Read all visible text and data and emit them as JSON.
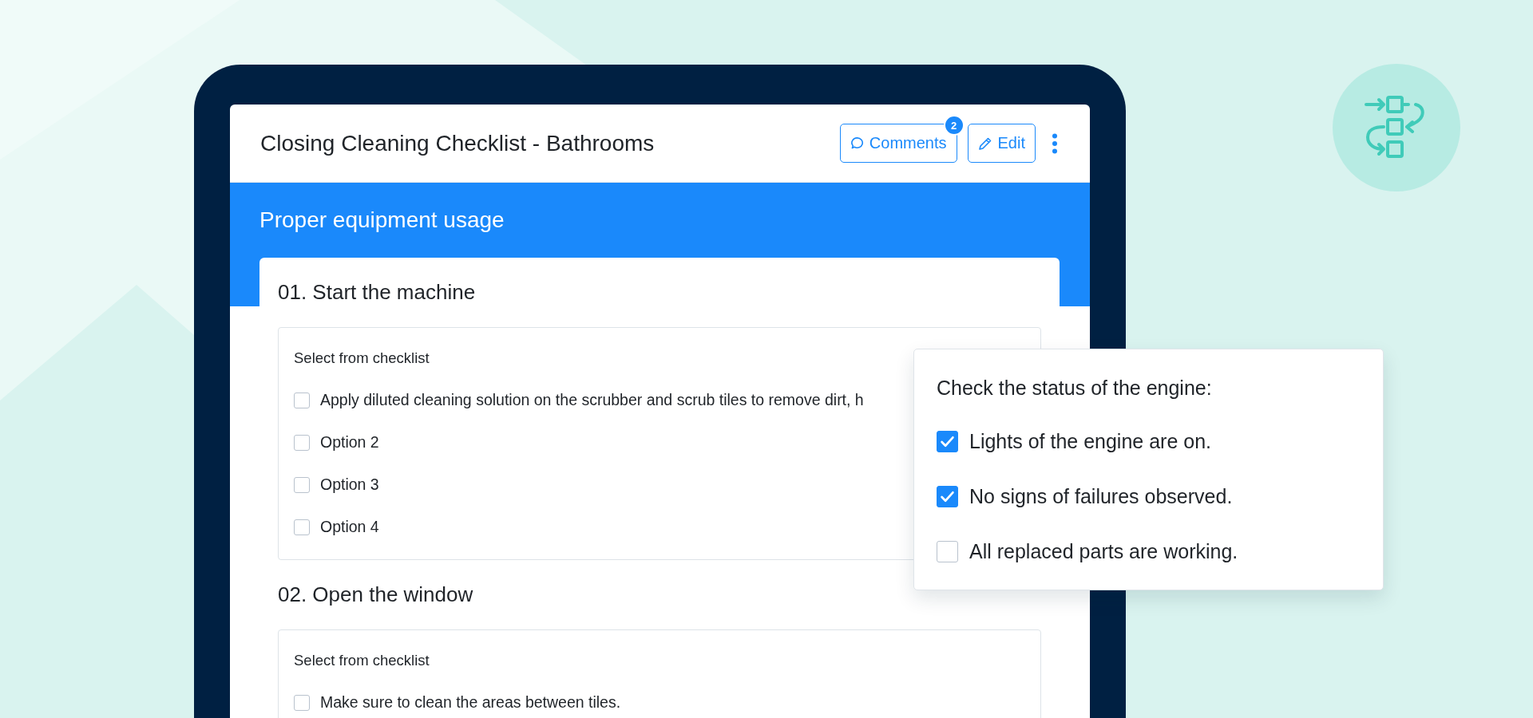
{
  "document": {
    "title": "Closing Cleaning Checklist - Bathrooms",
    "comments_button": {
      "label": "Comments",
      "badge": "2"
    },
    "edit_button": {
      "label": "Edit"
    }
  },
  "section": {
    "title": "Proper equipment usage"
  },
  "steps": [
    {
      "title": "01. Start the machine",
      "checklist_label": "Select from checklist",
      "items": [
        {
          "label": "Apply diluted cleaning solution on the scrubber and scrub tiles to remove dirt, h",
          "checked": false
        },
        {
          "label": "Option 2",
          "checked": false
        },
        {
          "label": "Option 3",
          "checked": false
        },
        {
          "label": "Option 4",
          "checked": false
        }
      ]
    },
    {
      "title": "02. Open the window",
      "checklist_label": "Select from checklist",
      "items": [
        {
          "label": "Make sure to clean the areas between tiles.",
          "checked": false
        }
      ]
    }
  ],
  "popup": {
    "title": "Check the status of the engine:",
    "items": [
      {
        "label": "Lights of the engine are on.",
        "checked": true
      },
      {
        "label": "No signs of failures observed.",
        "checked": true
      },
      {
        "label": "All replaced parts are working.",
        "checked": false
      }
    ]
  }
}
